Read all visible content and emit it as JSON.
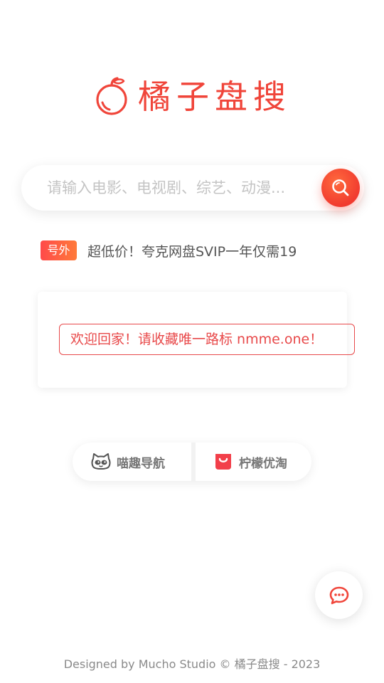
{
  "brand": {
    "name": "橘子盘搜",
    "accent_color": "#f0453a",
    "logo_icon": "orange-fruit-icon"
  },
  "search": {
    "placeholder": "请输入电影、电视剧、综艺、动漫...",
    "value": "",
    "button_icon": "search-icon"
  },
  "promo": {
    "badge": "号外",
    "text": "超低价！夸克网盘SVIP一年仅需19"
  },
  "notice": {
    "text": "欢迎回家！请收藏唯一路标 nmme.one！",
    "color": "#e8494a"
  },
  "links": [
    {
      "label": "喵趣导航",
      "icon": "cat-face-icon"
    },
    {
      "label": "柠檬优淘",
      "icon": "shopping-bag-icon"
    }
  ],
  "chat": {
    "icon": "chat-bubble-icon"
  },
  "footer": {
    "text": "Designed by Mucho Studio © 橘子盘搜 - 2023"
  }
}
